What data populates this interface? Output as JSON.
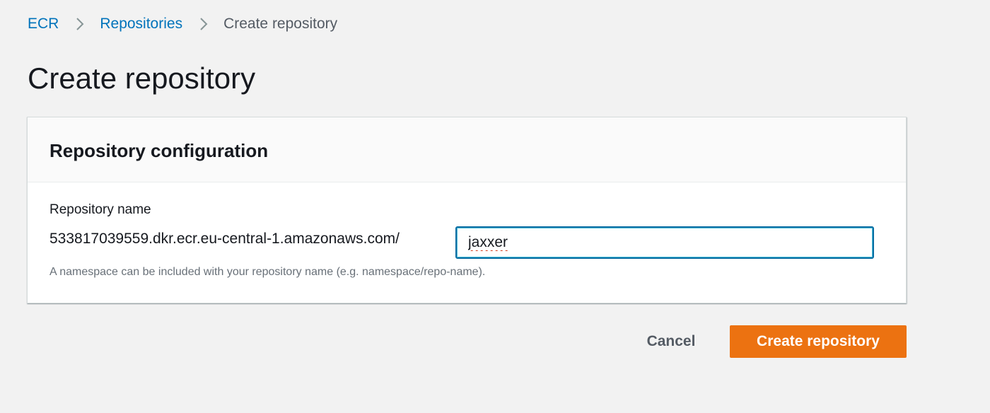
{
  "breadcrumb": {
    "items": [
      {
        "label": "ECR"
      },
      {
        "label": "Repositories"
      },
      {
        "label": "Create repository"
      }
    ],
    "separator_icon": "chevron-right-icon"
  },
  "page": {
    "title": "Create repository"
  },
  "panel": {
    "title": "Repository configuration",
    "field_label": "Repository name",
    "uri_prefix": "533817039559.dkr.ecr.eu-central-1.amazonaws.com/",
    "input_value": "jaxxer",
    "hint": "A namespace can be included with your repository name (e.g. namespace/repo-name)."
  },
  "actions": {
    "cancel_label": "Cancel",
    "create_label": "Create repository"
  },
  "colors": {
    "link": "#0073bb",
    "primary_button": "#ec7211",
    "input_focus_border": "#0a6ea3"
  }
}
